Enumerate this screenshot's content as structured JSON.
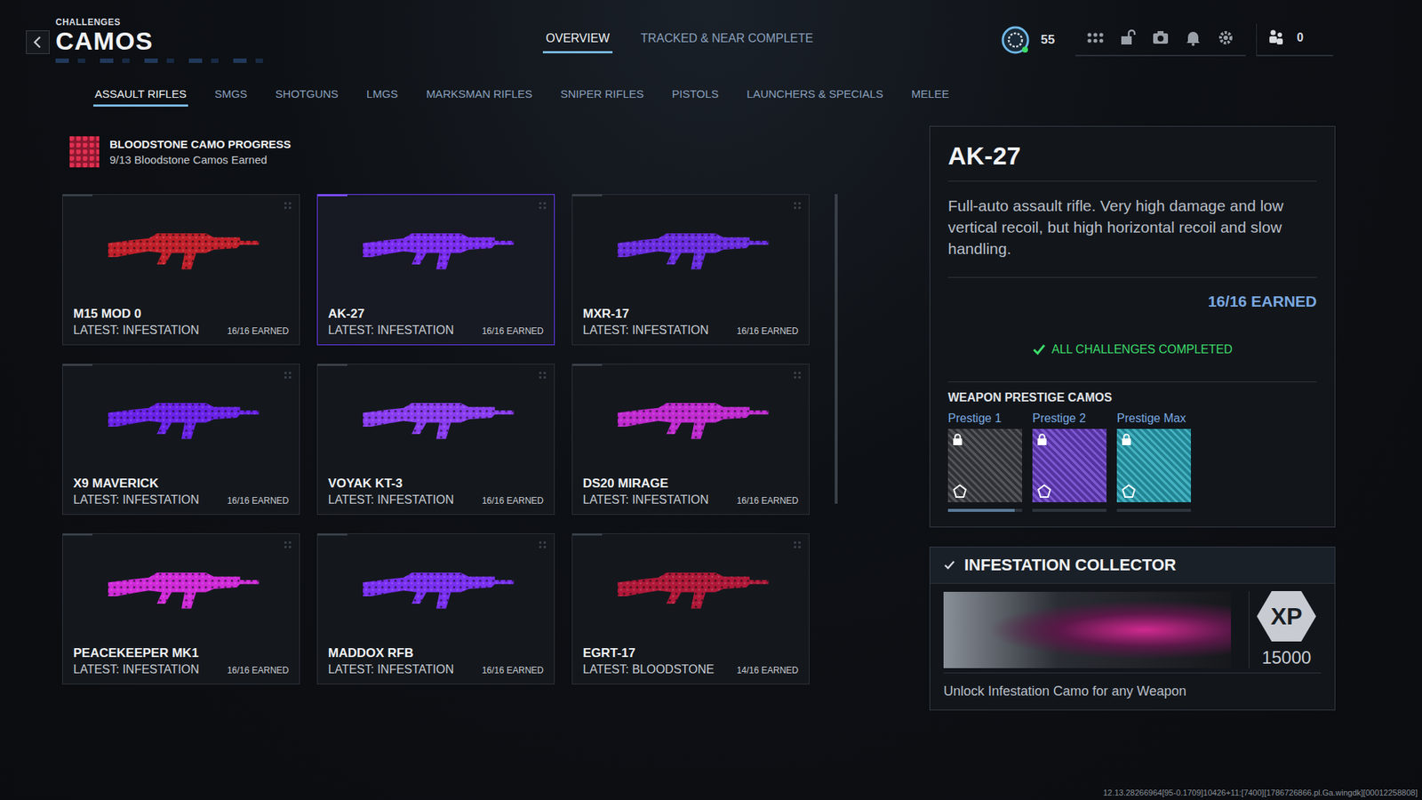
{
  "header": {
    "overline": "CHALLENGES",
    "title": "CAMOS"
  },
  "nav": [
    {
      "label": "OVERVIEW",
      "selected": true
    },
    {
      "label": "TRACKED & NEAR COMPLETE",
      "selected": false
    }
  ],
  "player": {
    "level": "55",
    "count": "0"
  },
  "categories": [
    {
      "label": "ASSAULT RIFLES",
      "selected": true
    },
    {
      "label": "SMGS",
      "selected": false
    },
    {
      "label": "SHOTGUNS",
      "selected": false
    },
    {
      "label": "LMGS",
      "selected": false
    },
    {
      "label": "MARKSMAN RIFLES",
      "selected": false
    },
    {
      "label": "SNIPER RIFLES",
      "selected": false
    },
    {
      "label": "PISTOLS",
      "selected": false
    },
    {
      "label": "LAUNCHERS & SPECIALS",
      "selected": false
    },
    {
      "label": "MELEE",
      "selected": false
    }
  ],
  "progress": {
    "title": "BLOODSTONE CAMO PROGRESS",
    "subtitle": "9/13 Bloodstone Camos Earned"
  },
  "weapons": [
    {
      "name": "M15 MOD 0",
      "latest": "LATEST: INFESTATION",
      "earned": "16/16 EARNED",
      "selected": false,
      "color": "#c0202a"
    },
    {
      "name": "AK-27",
      "latest": "LATEST: INFESTATION",
      "earned": "16/16 EARNED",
      "selected": true,
      "color": "#7a2cf0"
    },
    {
      "name": "MXR-17",
      "latest": "LATEST: INFESTATION",
      "earned": "16/16 EARNED",
      "selected": false,
      "color": "#6a2ce0"
    },
    {
      "name": "X9 MAVERICK",
      "latest": "LATEST: INFESTATION",
      "earned": "16/16 EARNED",
      "selected": false,
      "color": "#6a22e8"
    },
    {
      "name": "VOYAK KT-3",
      "latest": "LATEST: INFESTATION",
      "earned": "16/16 EARNED",
      "selected": false,
      "color": "#8a3cf0"
    },
    {
      "name": "DS20 MIRAGE",
      "latest": "LATEST: INFESTATION",
      "earned": "16/16 EARNED",
      "selected": false,
      "color": "#c02ad0"
    },
    {
      "name": "PEACEKEEPER MK1",
      "latest": "LATEST: INFESTATION",
      "earned": "16/16 EARNED",
      "selected": false,
      "color": "#d02ad8"
    },
    {
      "name": "MADDOX RFB",
      "latest": "LATEST: INFESTATION",
      "earned": "16/16 EARNED",
      "selected": false,
      "color": "#7a30f0"
    },
    {
      "name": "EGRT-17",
      "latest": "LATEST: BLOODSTONE",
      "earned": "14/16 EARNED",
      "selected": false,
      "color": "#b01838"
    }
  ],
  "detail": {
    "title": "AK-27",
    "description": "Full-auto assault rifle. Very high damage and low vertical recoil, but high horizontal recoil and slow handling.",
    "earned": "16/16 EARNED",
    "status": "ALL CHALLENGES COMPLETED",
    "prestige_title": "WEAPON PRESTIGE CAMOS",
    "prestige": [
      {
        "label": "Prestige 1",
        "locked": true,
        "level": 0.9,
        "color": "#3a3d42"
      },
      {
        "label": "Prestige 2",
        "locked": true,
        "level": 0,
        "color": "#6a40c8"
      },
      {
        "label": "Prestige Max",
        "locked": true,
        "level": 0,
        "color": "#2aa6b8"
      }
    ]
  },
  "reward": {
    "title": "INFESTATION COLLECTOR",
    "checked": true,
    "badge": "XP",
    "amount": "15000",
    "description": "Unlock Infestation Camo for any Weapon"
  },
  "footer": "12.13.28266964[95-0.1709]10426+11:[7400][1786726866.pl.Ga.wingdk][00012258808]"
}
